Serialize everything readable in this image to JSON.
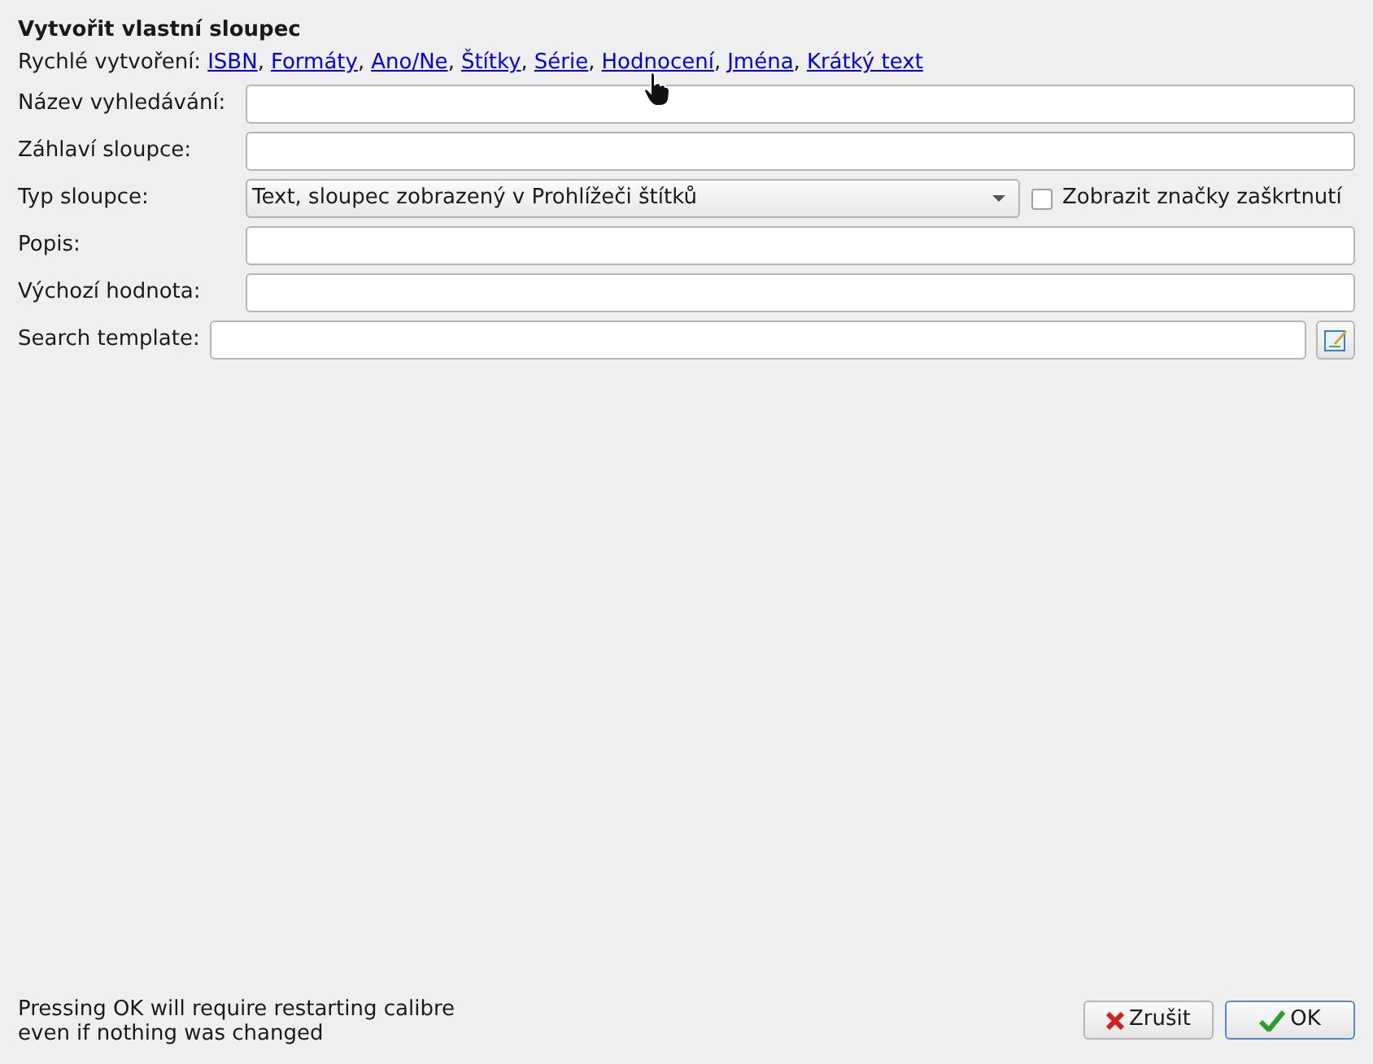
{
  "title": "Vytvořit vlastní sloupec",
  "quick_create": {
    "label": "Rychlé vytvoření:",
    "separator": ",",
    "links": [
      "ISBN",
      "Formáty",
      "Ano/Ne",
      "Štítky",
      "Série",
      "Hodnocení",
      "Jména",
      "Krátký text"
    ]
  },
  "fields": [
    {
      "kind": "text",
      "label": "Název vyhledávání:"
    },
    {
      "kind": "text",
      "label": "Záhlaví sloupce:"
    },
    {
      "kind": "select",
      "label": "Typ sloupce:",
      "value": "Text, sloupec zobrazený v Prohlížeči štítků",
      "checkbox": {
        "label": "Zobrazit značky zaškrtnutí",
        "checked": false
      }
    },
    {
      "kind": "text",
      "label": "Popis:"
    },
    {
      "kind": "text",
      "label": "Výchozí hodnota:"
    },
    {
      "kind": "template",
      "label": "Search template:"
    }
  ],
  "note": [
    "Pressing OK will require restarting calibre",
    "even if nothing was changed"
  ],
  "buttons": [
    {
      "kind": "cancel",
      "label": "Zrušit"
    },
    {
      "kind": "ok",
      "label": "OK"
    }
  ]
}
